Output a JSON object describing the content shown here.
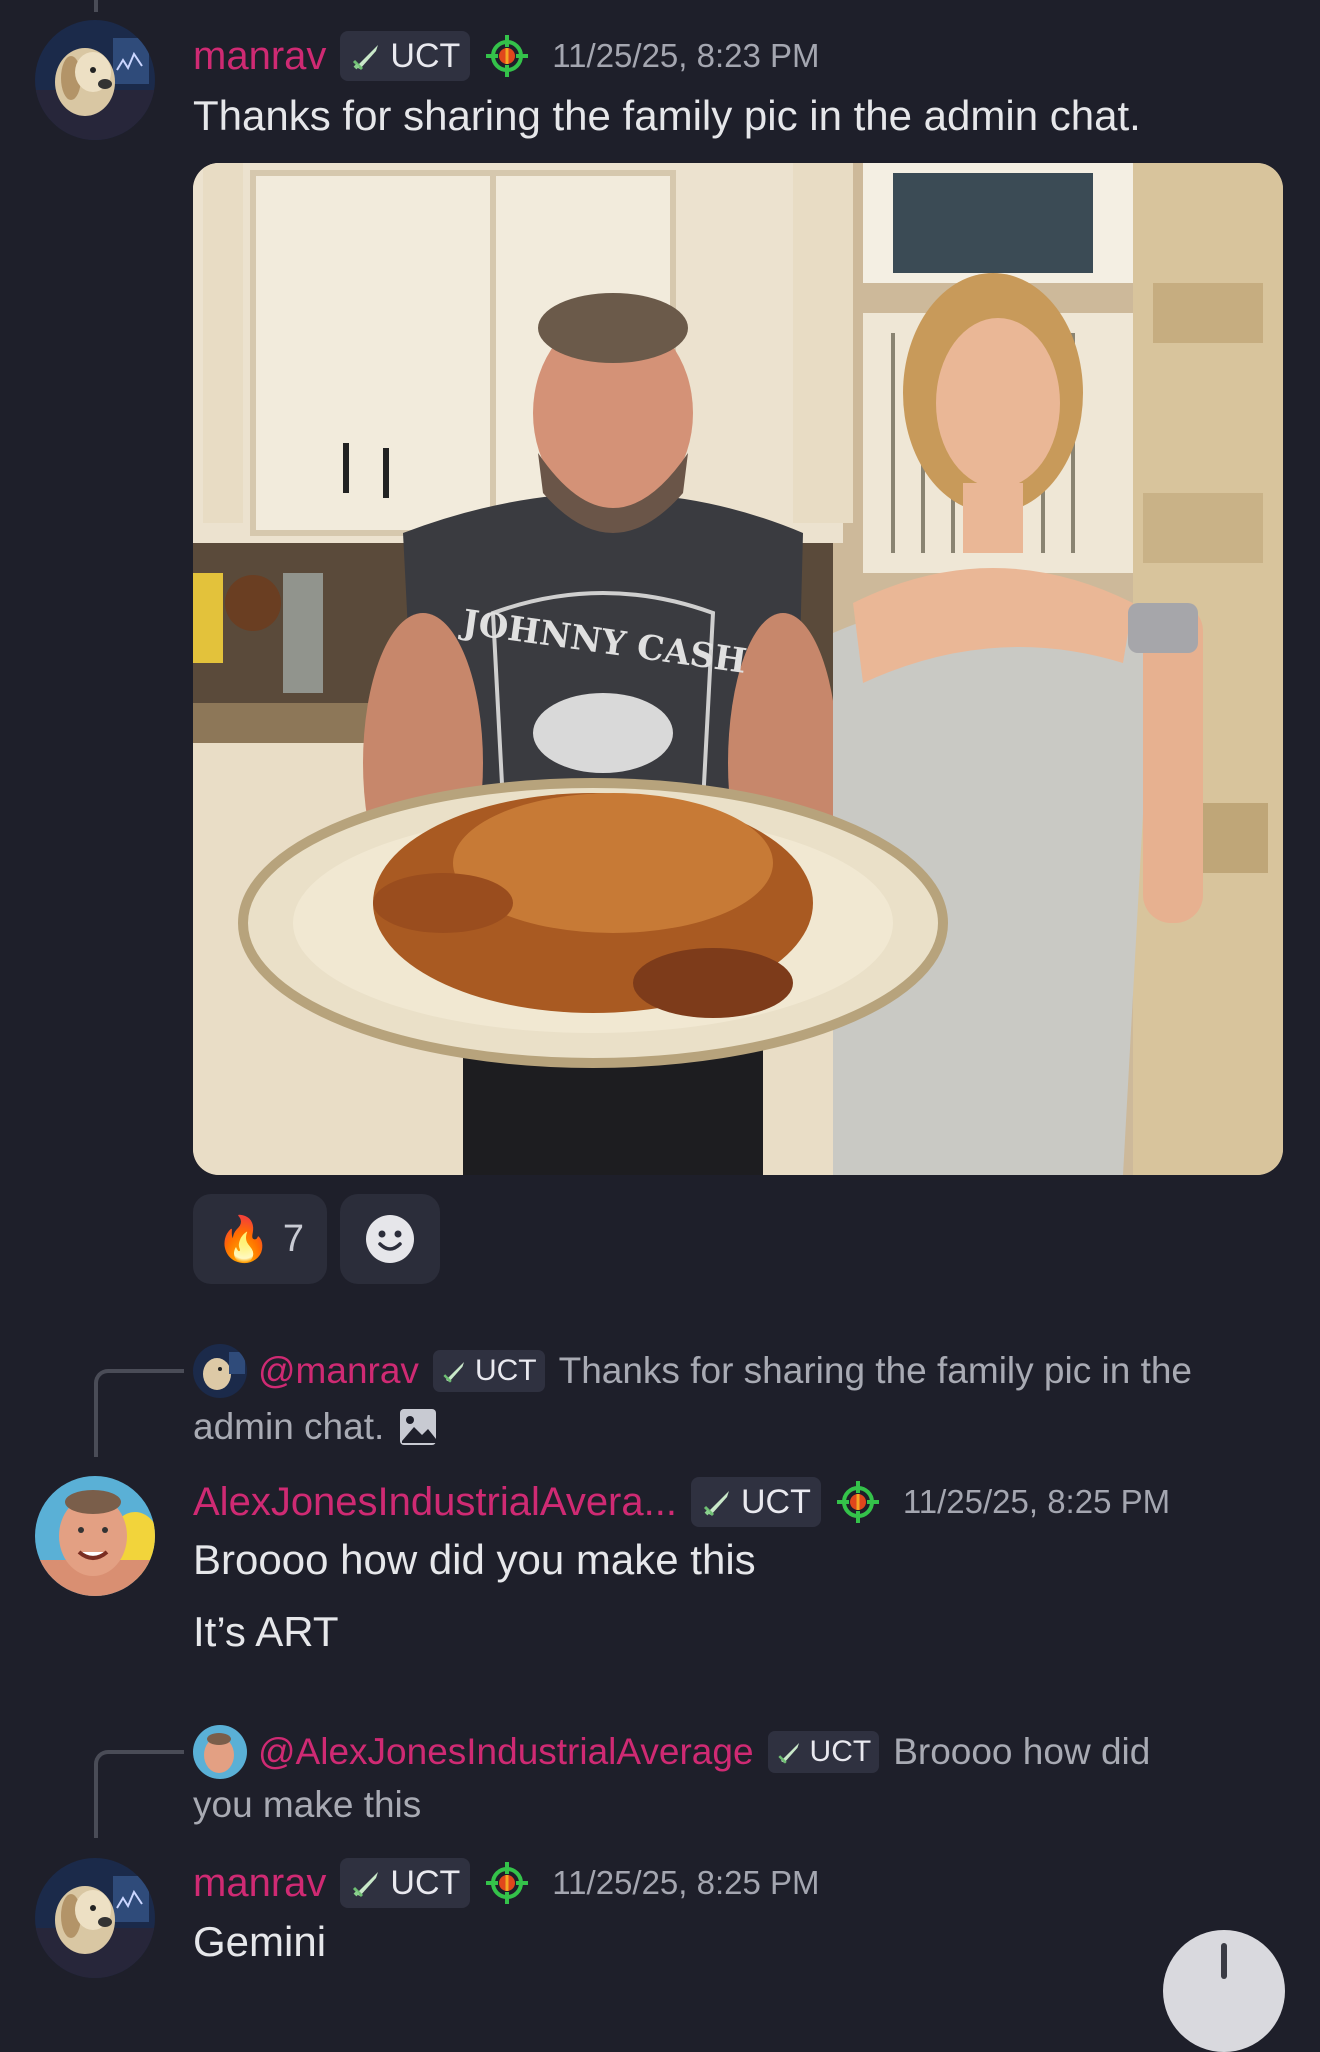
{
  "messages": [
    {
      "username": "manrav",
      "tag": "UCT",
      "timestamp": "11/25/25, 8:23 PM",
      "text": "Thanks for sharing the family pic in the admin chat.",
      "reactions": [
        {
          "emoji": "🔥",
          "count": "7"
        }
      ],
      "name_color": "#cf2a73"
    },
    {
      "reply": {
        "mention": "@manrav",
        "tag": "UCT",
        "text_line1": "Thanks for sharing the family pic in the",
        "text_line2": "admin chat."
      },
      "username": "AlexJonesIndustrialAvera...",
      "tag": "UCT",
      "timestamp": "11/25/25, 8:25 PM",
      "line1": "Broooo how did you make this",
      "line2": "It’s ART"
    },
    {
      "reply": {
        "mention": "@AlexJonesIndustrialAverage",
        "tag": "UCT",
        "text_line1": "Broooo how did",
        "text_line2": "you make this"
      },
      "username": "manrav",
      "tag": "UCT",
      "timestamp": "11/25/25, 8:25 PM",
      "text": "Gemini"
    }
  ],
  "photo": {
    "shirt_text": "JOHNNY CASH"
  },
  "colors": {
    "background": "#1e1f2a",
    "accent": "#cf2a73",
    "tag_bg": "#2f3140",
    "timestamp": "#a4a6b0"
  },
  "icons": [
    "sword-icon",
    "crosshair-icon",
    "add-reaction-icon",
    "image-attachment-icon",
    "scroll-down-icon"
  ]
}
